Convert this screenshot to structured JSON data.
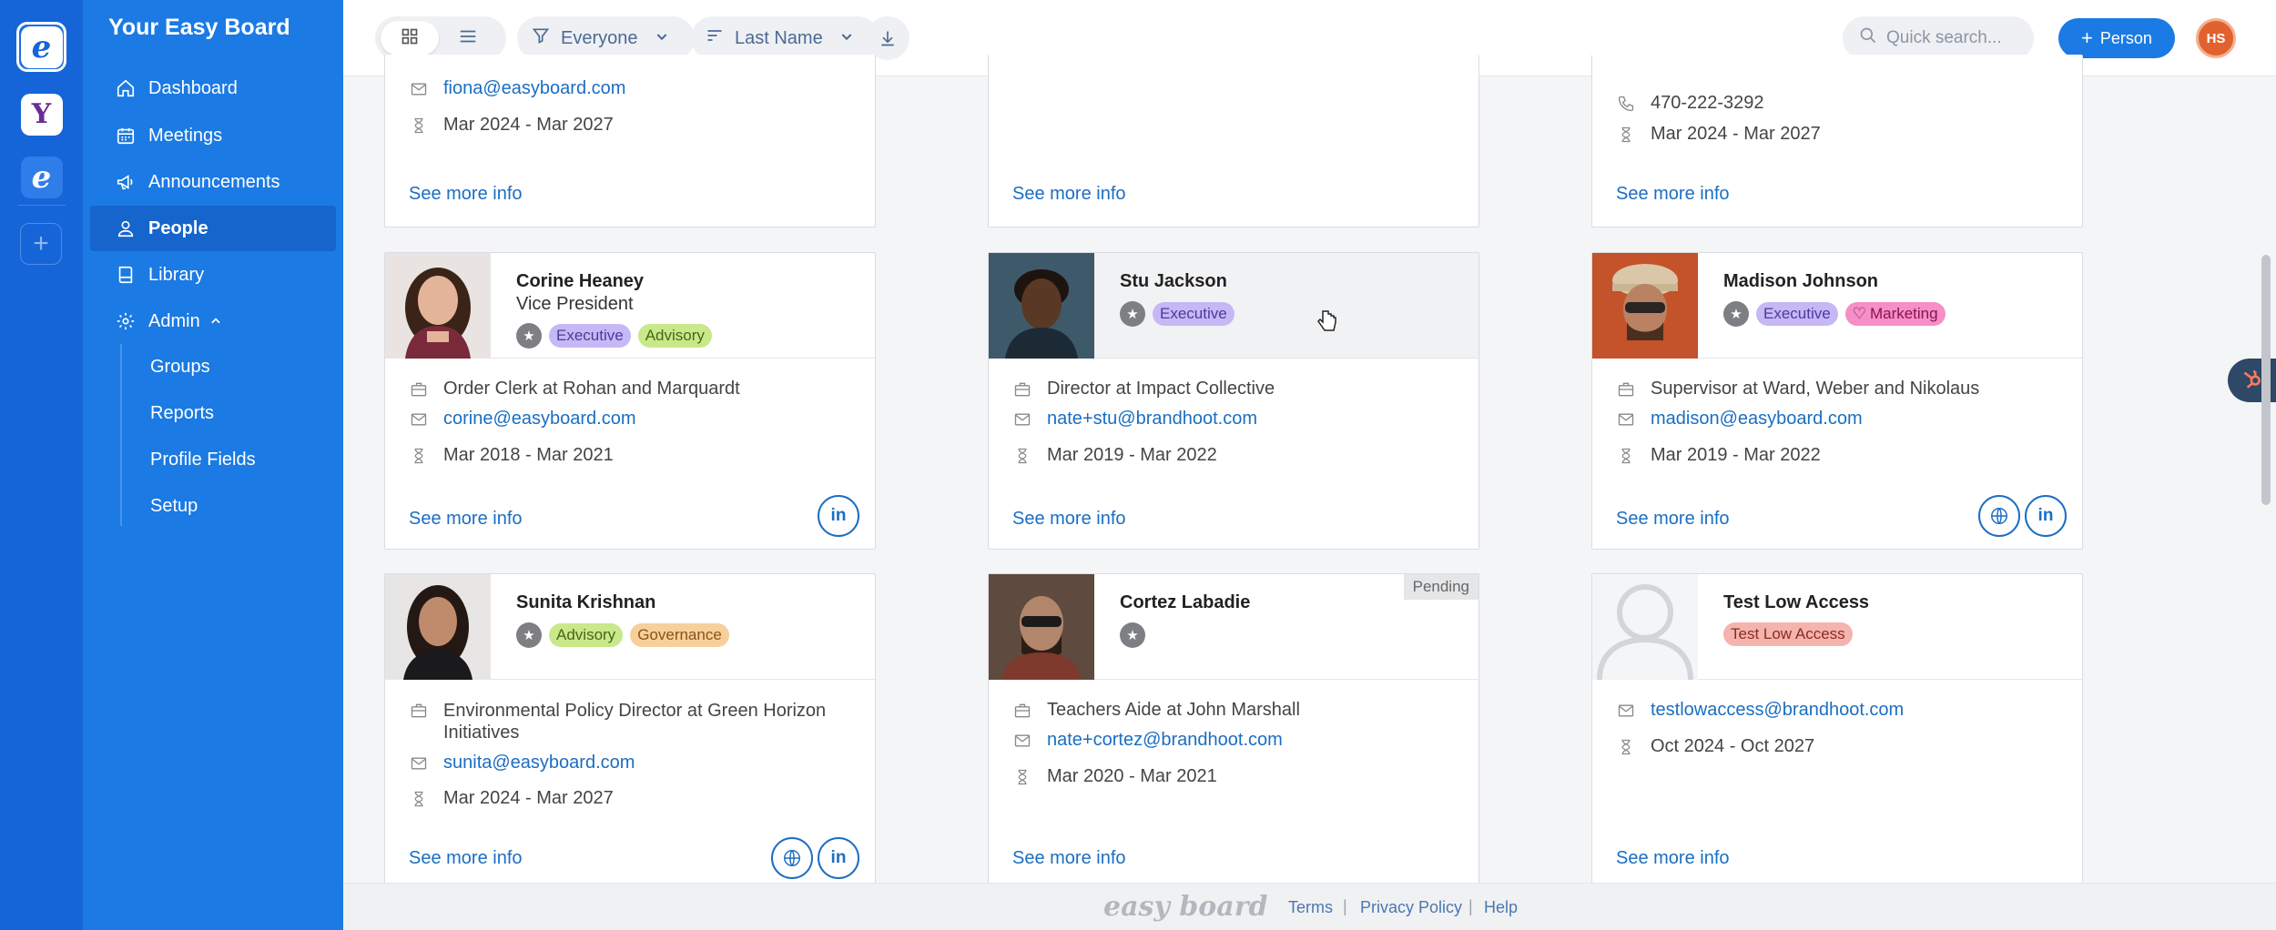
{
  "brand": "Your Easy Board",
  "nav": {
    "dashboard": "Dashboard",
    "meetings": "Meetings",
    "announcements": "Announcements",
    "people": "People",
    "library": "Library",
    "admin": "Admin",
    "groups": "Groups",
    "reports": "Reports",
    "profile_fields": "Profile Fields",
    "setup": "Setup"
  },
  "toolbar": {
    "filter_value": "Everyone",
    "sort_value": "Last Name",
    "search_placeholder": "Quick search...",
    "add_label": "Person",
    "user_initials": "HS"
  },
  "cards": [
    {
      "email": "fiona@easyboard.com",
      "term": "Mar 2024 - Mar 2027",
      "more": "See more info"
    },
    {
      "more": "See more info"
    },
    {
      "phone": "470-222-3292",
      "term": "Mar 2024 - Mar 2027",
      "more": "See more info"
    },
    {
      "name": "Corine Heaney",
      "title": "Vice President",
      "tags": [
        "Executive",
        "Advisory"
      ],
      "job": "Order Clerk at Rohan and Marquardt",
      "email": "corine@easyboard.com",
      "term": "Mar 2018 - Mar 2021",
      "more": "See more info"
    },
    {
      "name": "Stu Jackson",
      "tags": [
        "Executive"
      ],
      "job": "Director at Impact Collective",
      "email": "nate+stu@brandhoot.com",
      "term": "Mar 2019 - Mar 2022",
      "more": "See more info"
    },
    {
      "name": "Madison Johnson",
      "tags": [
        "Executive",
        "Marketing"
      ],
      "job": "Supervisor at Ward, Weber and Nikolaus",
      "email": "madison@easyboard.com",
      "term": "Mar 2019 - Mar 2022",
      "more": "See more info"
    },
    {
      "name": "Sunita Krishnan",
      "tags": [
        "Advisory",
        "Governance"
      ],
      "job_line1": "Environmental Policy Director at Green Horizon",
      "job_line2": "Initiatives",
      "email": "sunita@easyboard.com",
      "term": "Mar 2024 - Mar 2027",
      "more": "See more info"
    },
    {
      "name": "Cortez Labadie",
      "badge": "Pending",
      "job": "Teachers Aide at John Marshall",
      "email": "nate+cortez@brandhoot.com",
      "term": "Mar 2020 - Mar 2021",
      "more": "See more info"
    },
    {
      "name": "Test Low Access",
      "tags": [
        "Test Low Access"
      ],
      "email": "testlowaccess@brandhoot.com",
      "term": "Oct 2024 - Oct 2027",
      "more": "See more info"
    }
  ],
  "footer": {
    "logo": "easy board",
    "terms": "Terms",
    "privacy": "Privacy Policy",
    "help": "Help",
    "sep": "|"
  },
  "icons": [
    "grid-icon",
    "list-icon",
    "filter-icon",
    "sort-icon",
    "download-icon",
    "search-icon",
    "plus-icon",
    "mail-icon",
    "hourglass-icon",
    "phone-icon",
    "briefcase-icon",
    "star-icon",
    "linkedin-icon",
    "globe-icon"
  ],
  "colors": {
    "rail": "#1565d8",
    "sidebar": "#1b7ae3",
    "link": "#1b6ec2",
    "primary_button": "#1b7ae3"
  }
}
